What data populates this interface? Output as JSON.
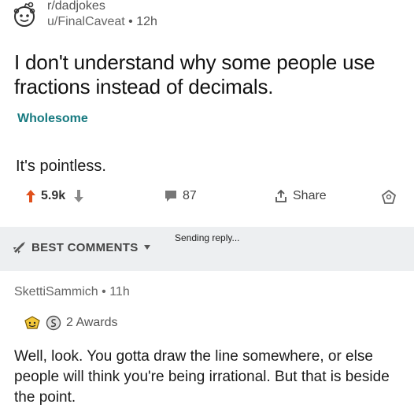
{
  "post": {
    "subreddit": "r/dadjokes",
    "author": "u/FinalCaveat",
    "separator": "•",
    "time": "12h",
    "title": "I don't understand why some people use fractions instead of decimals.",
    "flair": "Wholesome",
    "body": "It's pointless.",
    "upvotes": "5.9k",
    "comments": "87",
    "share_label": "Share"
  },
  "sort": {
    "label": "BEST COMMENTS",
    "status": "Sending reply..."
  },
  "comment": {
    "author": "SkettiSammich",
    "separator": "•",
    "time": "11h",
    "awards_label": "2 Awards",
    "text": "Well, look. You gotta draw the line somewhere, or else people will think you're being irrational. But that is beside the point."
  },
  "colors": {
    "upvote": "#e0501c",
    "flair": "#177a80",
    "sort_bar": "#edeff1",
    "text": "#1c1c1c"
  },
  "icons": [
    "reddit-snoo-icon",
    "upvote-arrow-icon",
    "downvote-arrow-icon",
    "comment-bubble-icon",
    "share-icon",
    "award-icon",
    "rocket-icon",
    "chevron-down-icon",
    "gold-award-icon",
    "silver-award-icon"
  ]
}
